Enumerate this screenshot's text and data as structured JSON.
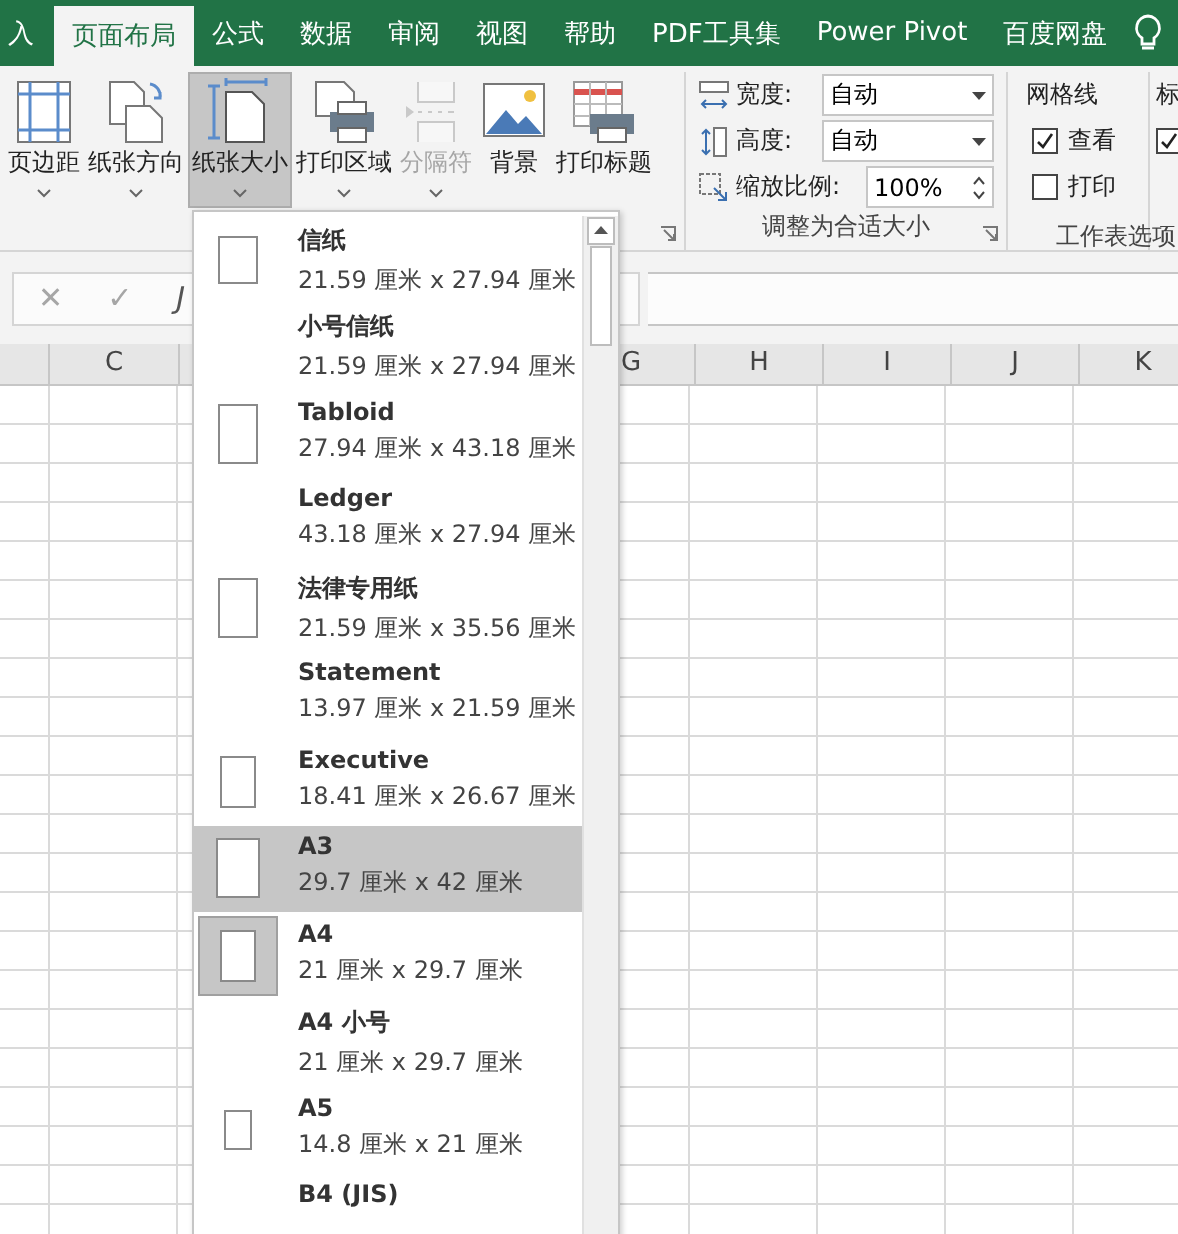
{
  "tabs": [
    {
      "label": "入",
      "selected": false
    },
    {
      "label": "页面布局",
      "selected": true
    },
    {
      "label": "公式",
      "selected": false
    },
    {
      "label": "数据",
      "selected": false
    },
    {
      "label": "审阅",
      "selected": false
    },
    {
      "label": "视图",
      "selected": false
    },
    {
      "label": "帮助",
      "selected": false
    },
    {
      "label": "PDF工具集",
      "selected": false
    },
    {
      "label": "Power Pivot",
      "selected": false
    },
    {
      "label": "百度网盘",
      "selected": false
    }
  ],
  "ribbon": {
    "page_setup": [
      {
        "label": "页边距",
        "kind": "margins",
        "pressed": false,
        "disabled": false
      },
      {
        "label": "纸张方向",
        "kind": "orientation",
        "pressed": false,
        "disabled": false
      },
      {
        "label": "纸张大小",
        "kind": "size",
        "pressed": true,
        "disabled": false
      },
      {
        "label": "打印区域",
        "kind": "print-area",
        "pressed": false,
        "disabled": false
      },
      {
        "label": "分隔符",
        "kind": "breaks",
        "pressed": false,
        "disabled": true
      },
      {
        "label": "背景",
        "kind": "background",
        "pressed": false,
        "disabled": false
      },
      {
        "label": "打印标题",
        "kind": "print-titles",
        "pressed": false,
        "disabled": false
      }
    ],
    "scale": {
      "width_label": "宽度:",
      "width_value": "自动",
      "height_label": "高度:",
      "height_value": "自动",
      "scale_label": "缩放比例:",
      "scale_value": "100%",
      "group_label": "调整为合适大小"
    },
    "sheet_options": {
      "gridlines_label": "网格线",
      "view": {
        "label": "查看",
        "checked": true
      },
      "print": {
        "label": "打印",
        "checked": false
      },
      "headings_label": "标",
      "headings_view_checked": true,
      "group_label": "工作表选项"
    }
  },
  "formula_bar": {
    "cancel": "✕",
    "enter": "✓",
    "function": "J"
  },
  "columns": [
    "C",
    "G",
    "H",
    "I",
    "J",
    "K"
  ],
  "paper_sizes": [
    {
      "name": "信纸",
      "size": "21.59 厘米 x 27.94 厘米",
      "kind": "small",
      "selected": false,
      "highlighted": false
    },
    {
      "name": "小号信纸",
      "size": "21.59 厘米 x 27.94 厘米",
      "kind": "none",
      "selected": false,
      "highlighted": false
    },
    {
      "name": "Tabloid",
      "size": "27.94 厘米 x 43.18 厘米",
      "kind": "tall",
      "selected": false,
      "highlighted": false
    },
    {
      "name": "Ledger",
      "size": "43.18 厘米 x 27.94 厘米",
      "kind": "none",
      "selected": false,
      "highlighted": false
    },
    {
      "name": "法律专用纸",
      "size": "21.59 厘米 x 35.56 厘米",
      "kind": "tall",
      "selected": false,
      "highlighted": false
    },
    {
      "name": "Statement",
      "size": "13.97 厘米 x 21.59 厘米",
      "kind": "none",
      "selected": false,
      "highlighted": false
    },
    {
      "name": "Executive",
      "size": "18.41 厘米 x 26.67 厘米",
      "kind": "medium",
      "selected": false,
      "highlighted": false
    },
    {
      "name": "A3",
      "size": "29.7 厘米 x 42 厘米",
      "kind": "large",
      "selected": false,
      "highlighted": true
    },
    {
      "name": "A4",
      "size": "21 厘米 x 29.7 厘米",
      "kind": "medium",
      "selected": true,
      "highlighted": false
    },
    {
      "name": "A4 小号",
      "size": "21 厘米 x 29.7 厘米",
      "kind": "none",
      "selected": false,
      "highlighted": false
    },
    {
      "name": "A5",
      "size": "14.8 厘米 x 21 厘米",
      "kind": "tiny",
      "selected": false,
      "highlighted": false
    },
    {
      "name": "B4 (JIS)",
      "kind": "none",
      "selected": false,
      "highlighted": false
    }
  ]
}
